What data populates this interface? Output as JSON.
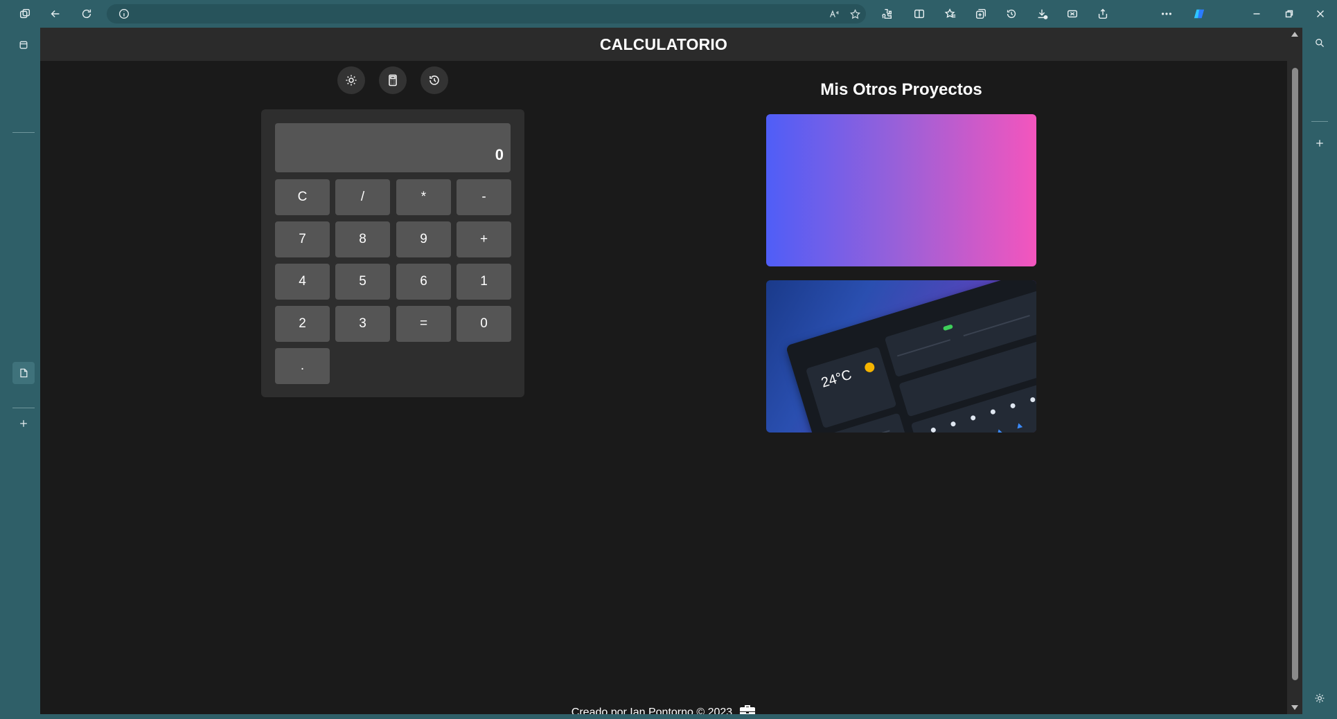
{
  "page": {
    "header_title": "CALCULATORIO",
    "projects_title": "Mis Otros Proyectos",
    "footer_text": "Creado por Ian Pontorno © 2023"
  },
  "modes": [
    {
      "name": "theme",
      "icon": "sun-icon"
    },
    {
      "name": "calculator",
      "icon": "calculator-icon"
    },
    {
      "name": "history",
      "icon": "history-icon"
    }
  ],
  "calculator": {
    "display_value": "0",
    "keys": [
      [
        "C",
        "/",
        "*",
        "-"
      ],
      [
        "7",
        "8",
        "9",
        "+"
      ],
      [
        "4",
        "5",
        "6",
        "1"
      ],
      [
        "2",
        "3",
        "=",
        "0"
      ],
      [
        "."
      ]
    ]
  },
  "projects": [
    {
      "type": "gradient",
      "colors": [
        "#4f5ef7",
        "#f455bd"
      ]
    },
    {
      "type": "weather-dashboard-preview",
      "temp_text": "24°C"
    }
  ],
  "browser": {
    "accent_color": "#2f5f68"
  }
}
